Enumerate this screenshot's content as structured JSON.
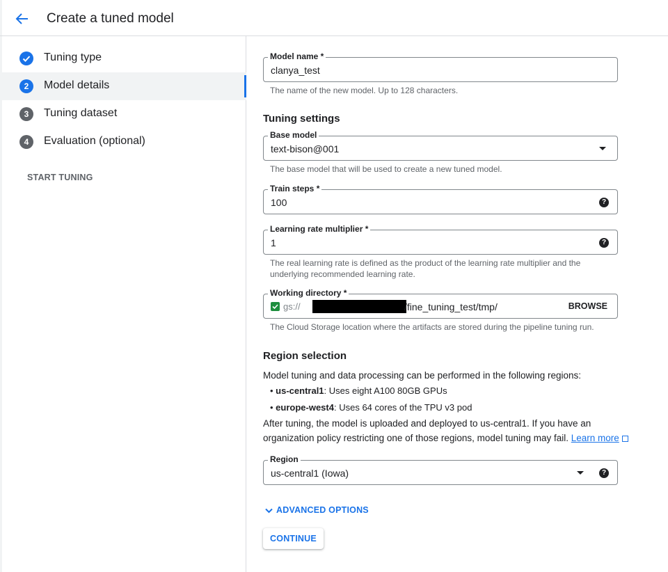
{
  "header": {
    "title": "Create a tuned model"
  },
  "steps": [
    {
      "label": "Tuning type",
      "number": "✓",
      "state": "done"
    },
    {
      "label": "Model details",
      "number": "2",
      "state": "active"
    },
    {
      "label": "Tuning dataset",
      "number": "3",
      "state": "todo"
    },
    {
      "label": "Evaluation (optional)",
      "number": "4",
      "state": "todo"
    }
  ],
  "sidebar": {
    "start_tuning": "START TUNING"
  },
  "model_name": {
    "label": "Model name *",
    "value": "clanya_test",
    "helper": "The name of the new model. Up to 128 characters."
  },
  "tuning_settings": {
    "title": "Tuning settings"
  },
  "base_model": {
    "label": "Base model",
    "value": "text-bison@001",
    "helper": "The base model that will be used to create a new tuned model."
  },
  "train_steps": {
    "label": "Train steps *",
    "value": "100"
  },
  "learning_rate": {
    "label": "Learning rate multiplier *",
    "value": "1",
    "helper_line1": "The real learning rate is defined as the product of the learning rate multiplier and the",
    "helper_line2": "underlying recommended learning rate."
  },
  "working_dir": {
    "label": "Working directory *",
    "prefix": "gs://",
    "suffix": "/fine_tuning_test/tmp/",
    "browse": "BROWSE",
    "helper": "The Cloud Storage location where the artifacts are stored during the pipeline tuning run."
  },
  "region_section": {
    "title": "Region selection",
    "intro": "Model tuning and data processing can be performed in the following regions:",
    "bullets": [
      {
        "name": "us-central1",
        "desc": ": Uses eight A100 80GB GPUs"
      },
      {
        "name": "europe-west4",
        "desc": ": Uses 64 cores of the TPU v3 pod"
      }
    ],
    "note_line1": "After tuning, the model is uploaded and deployed to us-central1. If you have an",
    "note_line2": "organization policy restricting one of those regions, model tuning may fail.",
    "learn_more": "Learn more"
  },
  "region": {
    "label": "Region",
    "value": "us-central1 (Iowa)"
  },
  "advanced_options": "ADVANCED OPTIONS",
  "continue_button": "CONTINUE",
  "colors": {
    "accent": "#1a73e8",
    "done": "#1a73e8",
    "todo": "#5f6368",
    "storage_green": "#1e8e3e"
  }
}
